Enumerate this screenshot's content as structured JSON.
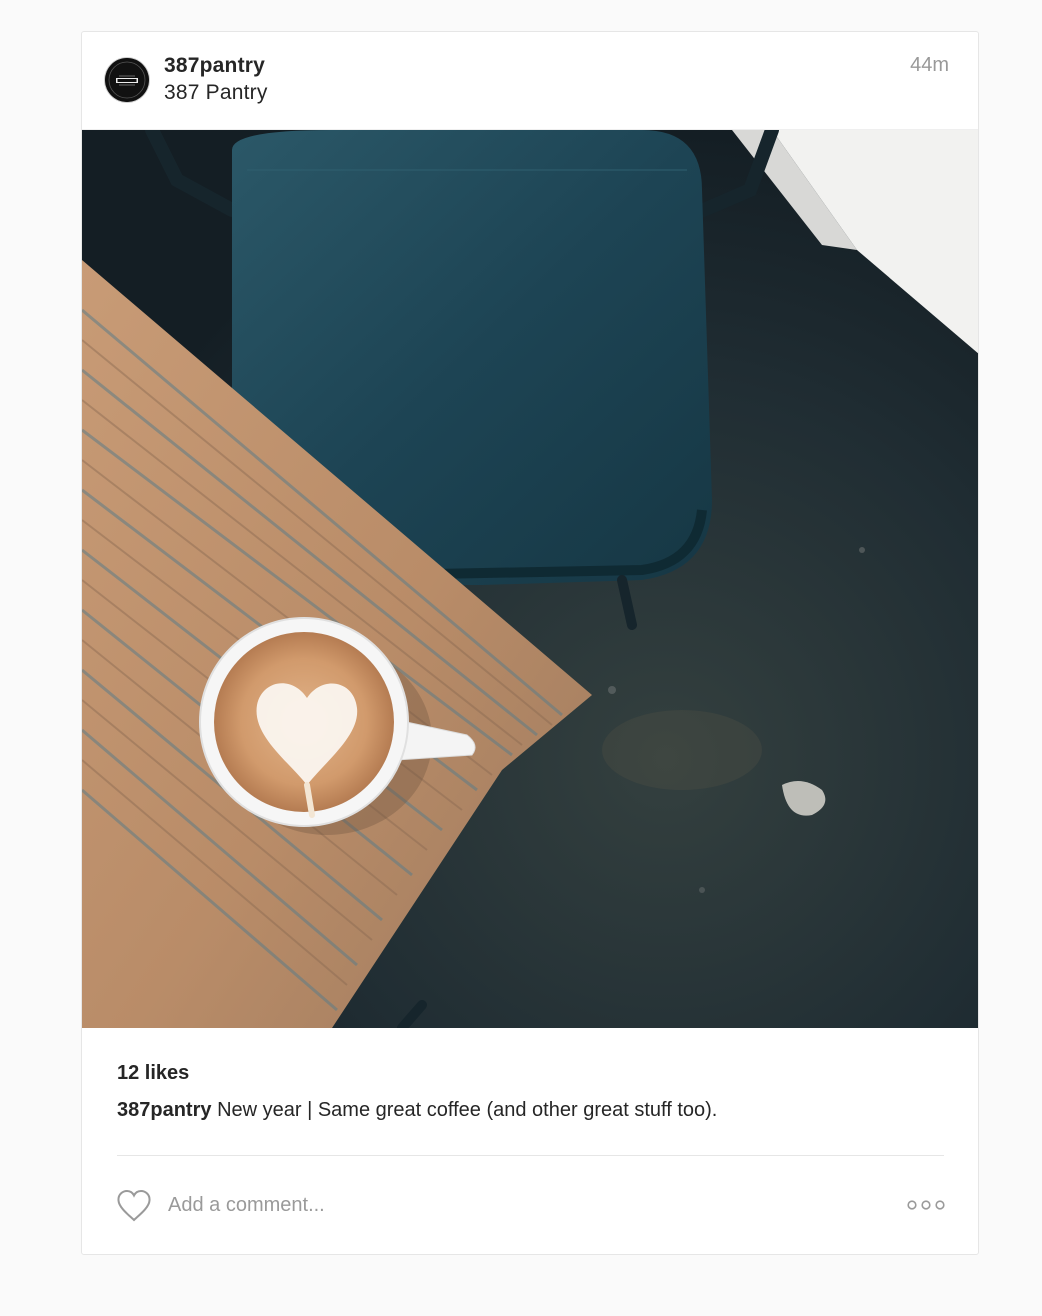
{
  "post": {
    "username": "387pantry",
    "location": "387 Pantry",
    "time_ago": "44m",
    "avatar": {
      "icon": "pantry-logo-icon",
      "logo_text": "PANTRY",
      "logo_small_text": "387"
    },
    "photo": {
      "alt": "Latte with heart art on wooden table next to blue chair"
    },
    "likes": "12 likes",
    "caption": {
      "username": "387pantry",
      "text": "New year | Same great coffee (and other great stuff too)."
    },
    "comment": {
      "placeholder": "Add a comment...",
      "value": ""
    },
    "icons": {
      "like": "heart-icon",
      "more": "more-options-icon"
    }
  }
}
